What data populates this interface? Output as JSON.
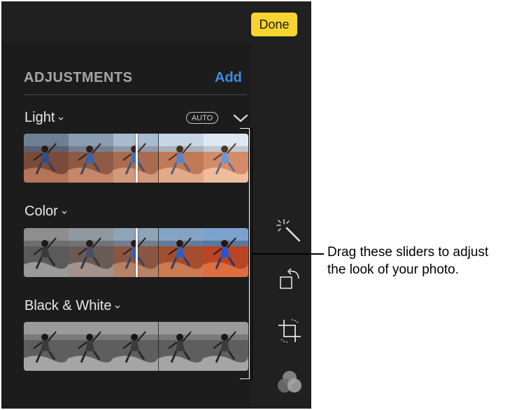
{
  "toolbar": {
    "done_label": "Done"
  },
  "adjustments": {
    "title": "ADJUSTMENTS",
    "add_label": "Add",
    "sections": [
      {
        "label": "Light",
        "auto_badge": "AUTO",
        "slider_value": 0.5
      },
      {
        "label": "Color",
        "slider_value": 0.5
      },
      {
        "label": "Black & White"
      }
    ]
  },
  "tools": [
    "magic-wand-icon",
    "rotate-icon",
    "crop-icon",
    "filters-icon"
  ],
  "callout": {
    "line1": "Drag these sliders to adjust",
    "line2": "the look of your photo."
  },
  "colors": {
    "done_bg": "#f6d531",
    "add_link": "#3a8fe0",
    "panel_bg": "#1c1c1c"
  }
}
